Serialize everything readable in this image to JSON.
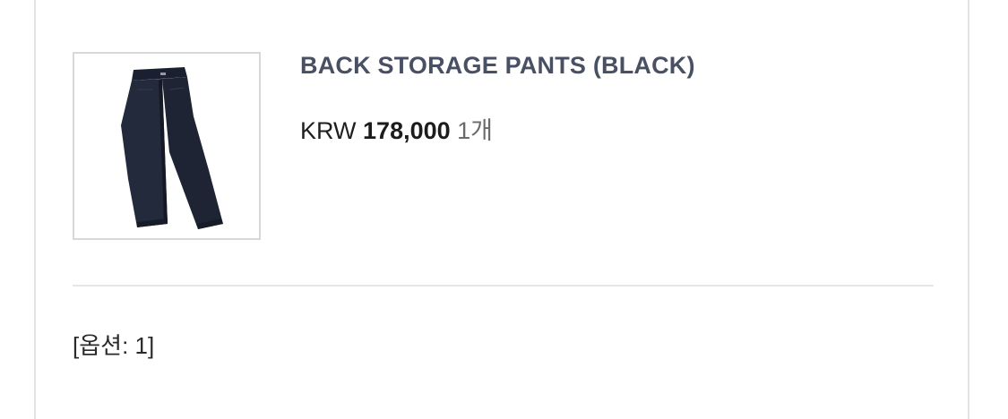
{
  "product": {
    "name": "BACK STORAGE PANTS (BLACK)",
    "currency": "KRW",
    "price": "178,000",
    "quantity": "1개",
    "image_icon": "pants-product-image"
  },
  "option": {
    "label": "[옵션: 1]"
  },
  "colors": {
    "title": "#4a5064",
    "pants": "#1e2433",
    "border": "#d8d8d8"
  }
}
